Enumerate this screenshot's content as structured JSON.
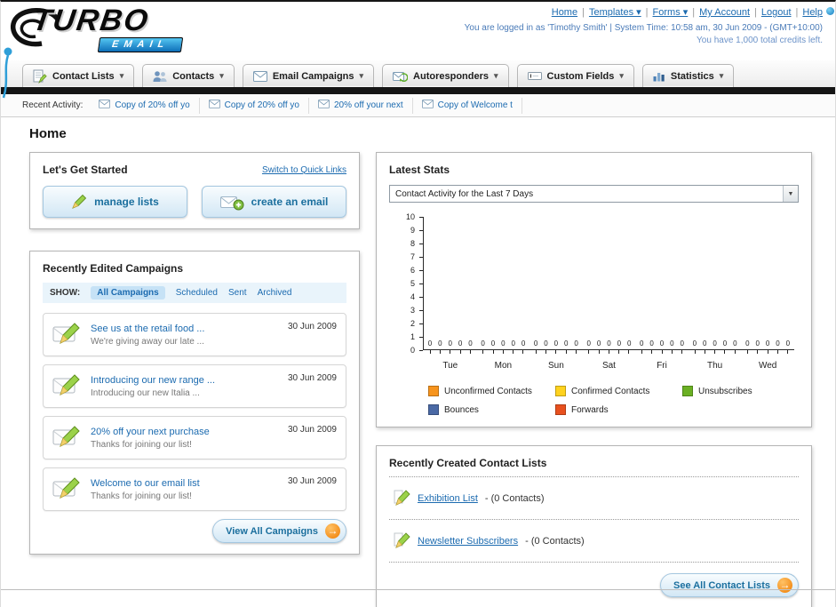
{
  "header": {
    "logo_main": "TURBO",
    "logo_sub": "EMAIL",
    "links": [
      {
        "label": "Home",
        "arrow": false
      },
      {
        "label": "Templates",
        "arrow": true
      },
      {
        "label": "Forms",
        "arrow": true
      },
      {
        "label": "My Account",
        "arrow": false
      },
      {
        "label": "Logout",
        "arrow": false
      },
      {
        "label": "Help",
        "arrow": false
      }
    ],
    "login_info": "You are logged in as 'Timothy Smith' | System Time: 10:58 am, 30 Jun 2009 - (GMT+10:00)",
    "credits": "You have 1,000 total credits left."
  },
  "nav": {
    "tabs": [
      {
        "label": "Contact Lists",
        "icon": "contact-lists"
      },
      {
        "label": "Contacts",
        "icon": "contacts"
      },
      {
        "label": "Email Campaigns",
        "icon": "email-campaigns"
      },
      {
        "label": "Autoresponders",
        "icon": "autoresponders"
      },
      {
        "label": "Custom Fields",
        "icon": "custom-fields"
      },
      {
        "label": "Statistics",
        "icon": "statistics"
      }
    ]
  },
  "activity": {
    "label": "Recent Activity:",
    "items": [
      "Copy of 20% off yo",
      "Copy of 20% off yo",
      "20% off your next",
      "Copy of Welcome t"
    ]
  },
  "page_title": "Home",
  "get_started": {
    "title": "Let's Get Started",
    "switch_link": "Switch to Quick Links",
    "manage_lists_label": "manage lists",
    "create_email_label": "create an email"
  },
  "campaigns": {
    "title": "Recently Edited Campaigns",
    "show_label": "SHOW:",
    "filters": [
      "All Campaigns",
      "Scheduled",
      "Sent",
      "Archived"
    ],
    "selected_filter": "All Campaigns",
    "items": [
      {
        "title": "See us at the retail food ...",
        "subtitle": "We're giving away our late ...",
        "date": "30 Jun 2009"
      },
      {
        "title": "Introducing our new range ...",
        "subtitle": "Introducing our new Italia ...",
        "date": "30 Jun 2009"
      },
      {
        "title": "20% off your next purchase",
        "subtitle": "Thanks for joining our list!",
        "date": "30 Jun 2009"
      },
      {
        "title": "Welcome to our email list",
        "subtitle": "Thanks for joining our list!",
        "date": "30 Jun 2009"
      }
    ],
    "view_all_label": "View All Campaigns"
  },
  "stats": {
    "title": "Latest Stats",
    "dropdown_value": "Contact Activity for the Last 7 Days"
  },
  "chart_data": {
    "type": "bar",
    "title": "Contact Activity for the Last 7 Days",
    "categories": [
      "Tue",
      "Mon",
      "Sun",
      "Sat",
      "Fri",
      "Thu",
      "Wed"
    ],
    "series": [
      {
        "name": "Unconfirmed Contacts",
        "color": "#f7941d",
        "values": [
          0,
          0,
          0,
          0,
          0,
          0,
          0
        ]
      },
      {
        "name": "Confirmed Contacts",
        "color": "#ffd21e",
        "values": [
          0,
          0,
          0,
          0,
          0,
          0,
          0
        ]
      },
      {
        "name": "Unsubscribes",
        "color": "#6ab023",
        "values": [
          0,
          0,
          0,
          0,
          0,
          0,
          0
        ]
      },
      {
        "name": "Bounces",
        "color": "#4a69a5",
        "values": [
          0,
          0,
          0,
          0,
          0,
          0,
          0
        ]
      },
      {
        "name": "Forwards",
        "color": "#e8501e",
        "values": [
          0,
          0,
          0,
          0,
          0,
          0,
          0
        ]
      }
    ],
    "ylim": [
      0,
      10
    ],
    "ytick_step": 1,
    "value_labels_shown": true,
    "grid": false,
    "legend_position": "bottom"
  },
  "contact_lists": {
    "title": "Recently Created Contact Lists",
    "items": [
      {
        "name": "Exhibition List",
        "detail": "- (0 Contacts)"
      },
      {
        "name": "Newsletter Subscribers",
        "detail": "- (0 Contacts)"
      }
    ],
    "see_all_label": "See All Contact Lists"
  }
}
